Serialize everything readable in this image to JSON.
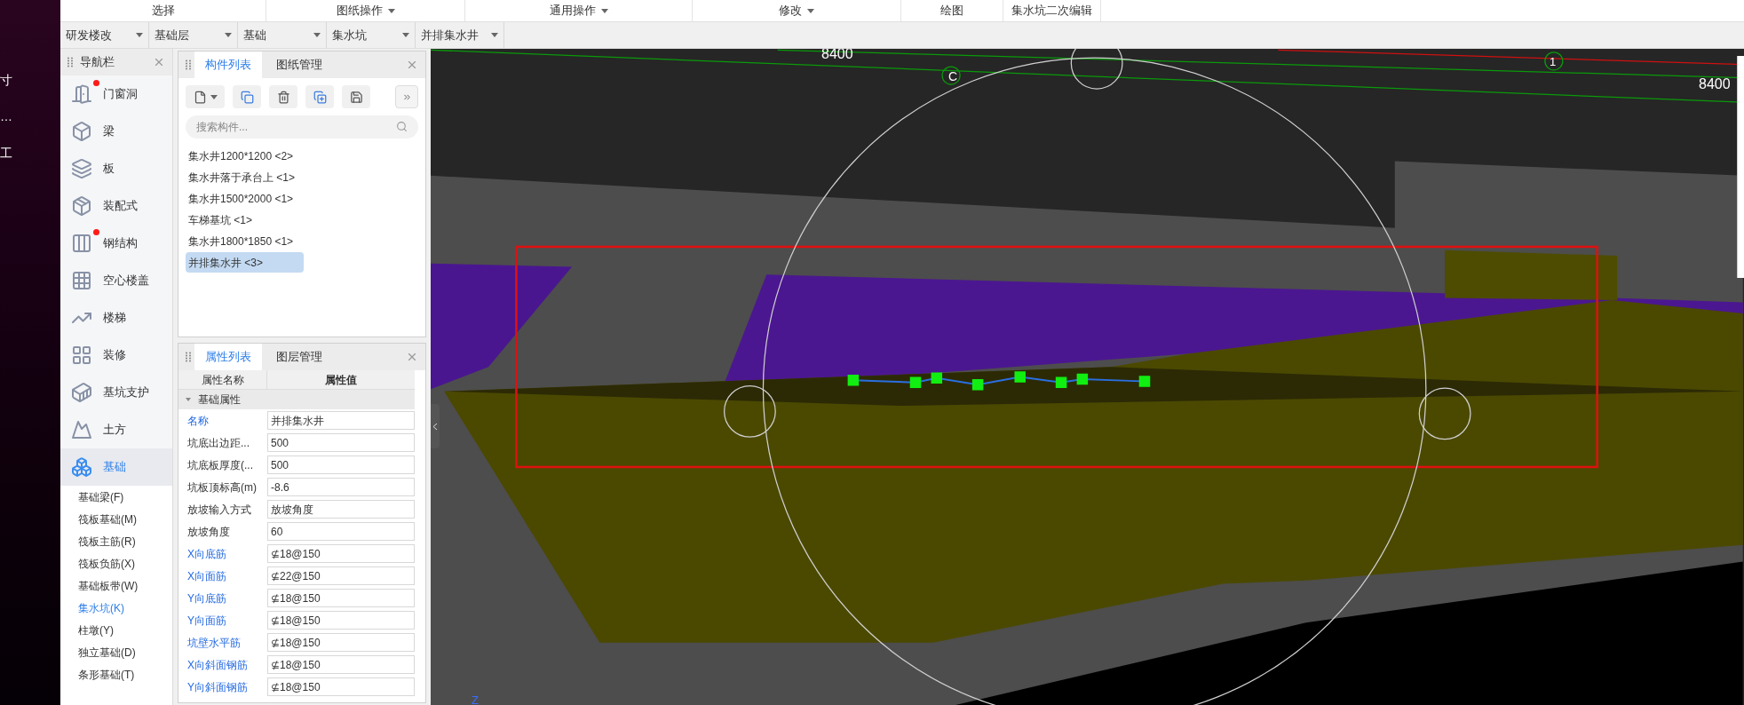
{
  "desktop_fragments": [
    "寸",
    "…",
    "工"
  ],
  "ribbon": [
    {
      "label": "选择",
      "dropdown": false
    },
    {
      "label": "图纸操作",
      "dropdown": true
    },
    {
      "label": "通用操作",
      "dropdown": true
    },
    {
      "label": "修改",
      "dropdown": true
    },
    {
      "label": "绘图",
      "dropdown": false
    },
    {
      "label": "集水坑二次编辑",
      "dropdown": false
    }
  ],
  "selectors": [
    "研发楼改",
    "基础层",
    "基础",
    "集水坑",
    "并排集水井"
  ],
  "nav": {
    "title": "导航栏",
    "items": [
      {
        "label": "门窗洞",
        "badge": true,
        "selected": false
      },
      {
        "label": "梁",
        "badge": false,
        "selected": false
      },
      {
        "label": "板",
        "badge": false,
        "selected": false
      },
      {
        "label": "装配式",
        "badge": false,
        "selected": false
      },
      {
        "label": "钢结构",
        "badge": true,
        "selected": false
      },
      {
        "label": "空心楼盖",
        "badge": false,
        "selected": false
      },
      {
        "label": "楼梯",
        "badge": false,
        "selected": false
      },
      {
        "label": "装修",
        "badge": false,
        "selected": false
      },
      {
        "label": "基坑支护",
        "badge": false,
        "selected": false
      },
      {
        "label": "土方",
        "badge": false,
        "selected": false
      },
      {
        "label": "基础",
        "badge": false,
        "selected": true
      }
    ],
    "sub_items": [
      {
        "label": "基础梁(F)",
        "selected": false
      },
      {
        "label": "筏板基础(M)",
        "selected": false
      },
      {
        "label": "筏板主筋(R)",
        "selected": false
      },
      {
        "label": "筏板负筋(X)",
        "selected": false
      },
      {
        "label": "基础板带(W)",
        "selected": false
      },
      {
        "label": "集水坑(K)",
        "selected": true
      },
      {
        "label": "柱墩(Y)",
        "selected": false
      },
      {
        "label": "独立基础(D)",
        "selected": false
      },
      {
        "label": "条形基础(T)",
        "selected": false
      }
    ]
  },
  "component_panel": {
    "tabs": [
      {
        "label": "构件列表",
        "selected": true
      },
      {
        "label": "图纸管理",
        "selected": false
      }
    ],
    "search": {
      "placeholder": "搜索构件..."
    },
    "items": [
      {
        "label": "集水井1200*1200 <2>",
        "selected": false
      },
      {
        "label": "集水井落于承台上 <1>",
        "selected": false
      },
      {
        "label": "集水井1500*2000 <1>",
        "selected": false
      },
      {
        "label": "车梯基坑 <1>",
        "selected": false
      },
      {
        "label": "集水井1800*1850 <1>",
        "selected": false
      },
      {
        "label": "并排集水井 <3>",
        "selected": true
      }
    ]
  },
  "property_panel": {
    "tabs": [
      {
        "label": "属性列表",
        "selected": true
      },
      {
        "label": "图层管理",
        "selected": false
      }
    ],
    "columns": [
      "属性名称",
      "属性值"
    ],
    "group": {
      "label": "基础属性",
      "expanded": true
    },
    "rows": [
      {
        "name": "名称",
        "value": "并排集水井",
        "public": true
      },
      {
        "name": "坑底出边距...",
        "value": "500",
        "public": false
      },
      {
        "name": "坑底板厚度(...",
        "value": "500",
        "public": false
      },
      {
        "name": "坑板顶标高(m)",
        "value": "-8.6",
        "public": false
      },
      {
        "name": "放坡输入方式",
        "value": "放坡角度",
        "public": false
      },
      {
        "name": "放坡角度",
        "value": "60",
        "public": false
      },
      {
        "name": "X向底筋",
        "value": "⊈18@150",
        "public": true
      },
      {
        "name": "X向面筋",
        "value": "⊈22@150",
        "public": true
      },
      {
        "name": "Y向底筋",
        "value": "⊈18@150",
        "public": true
      },
      {
        "name": "Y向面筋",
        "value": "⊈18@150",
        "public": true
      },
      {
        "name": "坑壁水平筋",
        "value": "⊈18@150",
        "public": true
      },
      {
        "name": "X向斜面钢筋",
        "value": "⊈18@150",
        "public": true
      },
      {
        "name": "Y向斜面钢筋",
        "value": "⊈18@150",
        "public": true
      }
    ]
  },
  "viewport": {
    "dimension_labels": [
      "8400",
      "8400"
    ],
    "axis_markers": [
      "C",
      "1"
    ],
    "axis_label": "Z"
  }
}
